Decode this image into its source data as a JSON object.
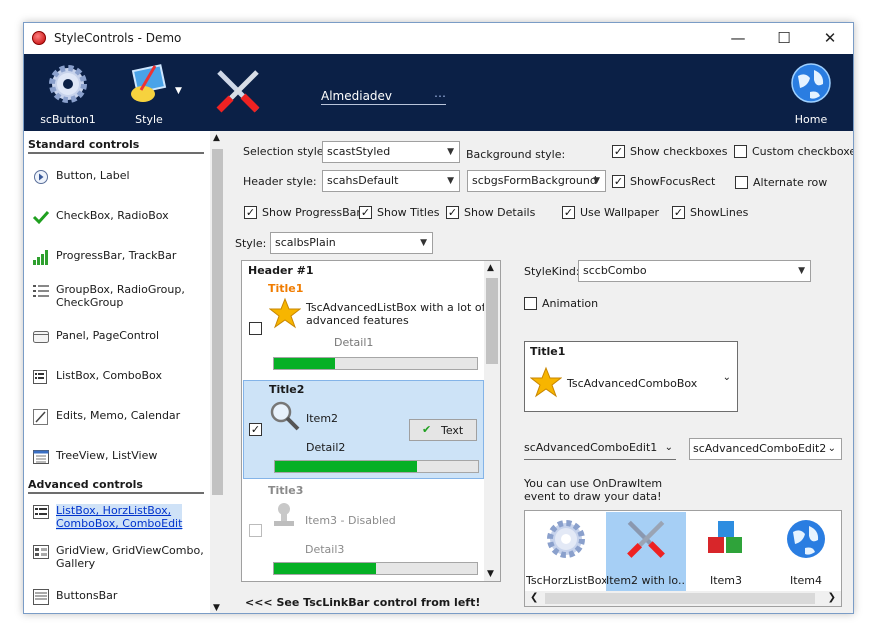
{
  "window": {
    "title": "StyleControls - Demo",
    "minimize": "—",
    "maximize": "☐",
    "close": "✕"
  },
  "toolbar": {
    "button1_label": "scButton1",
    "style_label": "Style",
    "center_text": "Almediadev",
    "center_dots": "⋯",
    "home_label": "Home"
  },
  "sidebar": {
    "standard_header": "Standard controls",
    "standard_items": [
      {
        "label": "Button, Label",
        "icon": "radio-button-icon"
      },
      {
        "label": "CheckBox, RadioBox",
        "icon": "checkmark-icon"
      },
      {
        "label": "ProgressBar, TrackBar",
        "icon": "signal-bars-icon"
      },
      {
        "label": "GroupBox, RadioGroup,\nCheckGroup",
        "icon": "list-icon"
      },
      {
        "label": "Panel, PageControl",
        "icon": "panel-icon"
      },
      {
        "label": "ListBox, ComboBox",
        "icon": "listbox-icon"
      },
      {
        "label": "Edits, Memo, Calendar",
        "icon": "edit-icon"
      },
      {
        "label": "TreeView, ListView",
        "icon": "treeview-icon"
      }
    ],
    "advanced_header": "Advanced controls",
    "advanced_items": [
      {
        "label": "ListBox, HorzListBox,\nComboBox, ComboEdit",
        "icon": "listbox-icon"
      },
      {
        "label": "GridView, GridViewCombo,\nGallery",
        "icon": "grid-icon"
      },
      {
        "label": "ButtonsBar",
        "icon": "buttonsbar-icon"
      }
    ]
  },
  "settings": {
    "selection_style_label": "Selection style:",
    "selection_style_value": "scastStyled",
    "background_style_label": "Background style:",
    "header_style_label": "Header style:",
    "header_style_value": "scahsDefault",
    "background_style_value": "scbgsFormBackground",
    "show_checkboxes": "Show checkboxes",
    "custom_checkboxes": "Custom checkboxes",
    "show_focus_rect": "ShowFocusRect",
    "alternate_row": "Alternate row",
    "show_progressbar": "Show ProgressBar",
    "show_titles": "Show Titles",
    "show_details": "Show Details",
    "use_wallpaper": "Use Wallpaper",
    "show_lines": "ShowLines",
    "style_label": "Style:",
    "style_value": "scalbsPlain"
  },
  "listbox": {
    "header": "Header #1",
    "items": [
      {
        "title": "Title1",
        "caption": "TscAdvancedListBox with a lot of\nadvanced features",
        "detail": "Detail1",
        "progress": 0.3,
        "checked": false
      },
      {
        "title": "Title2",
        "caption": "Item2",
        "detail": "Detail2",
        "progress": 0.7,
        "checked": true,
        "button": "Text"
      },
      {
        "title": "Title3",
        "caption": "Item3 - Disabled",
        "detail": "Detail3",
        "progress": 0.5,
        "checked": false
      }
    ]
  },
  "right": {
    "stylekind_label": "StyleKind:",
    "stylekind_value": "sccbCombo",
    "animation_label": "Animation",
    "combo_title": "Title1",
    "combo_caption": "TscAdvancedComboBox",
    "edit1": "scAdvancedComboEdit1",
    "edit2": "scAdvancedComboEdit2",
    "ondraw_text": "You can use OnDrawItem\nevent to draw your data!",
    "horz_items": [
      "TscHorzListBox",
      "Item2 with lo...",
      "Item3",
      "Item4"
    ]
  },
  "footer_text": "<<< See TscLinkBar control from left!",
  "colors": {
    "toolbar_bg": "#0b2046",
    "selection": "#cde3f7",
    "progress": "#06b025",
    "title_orange": "#f07c00"
  }
}
